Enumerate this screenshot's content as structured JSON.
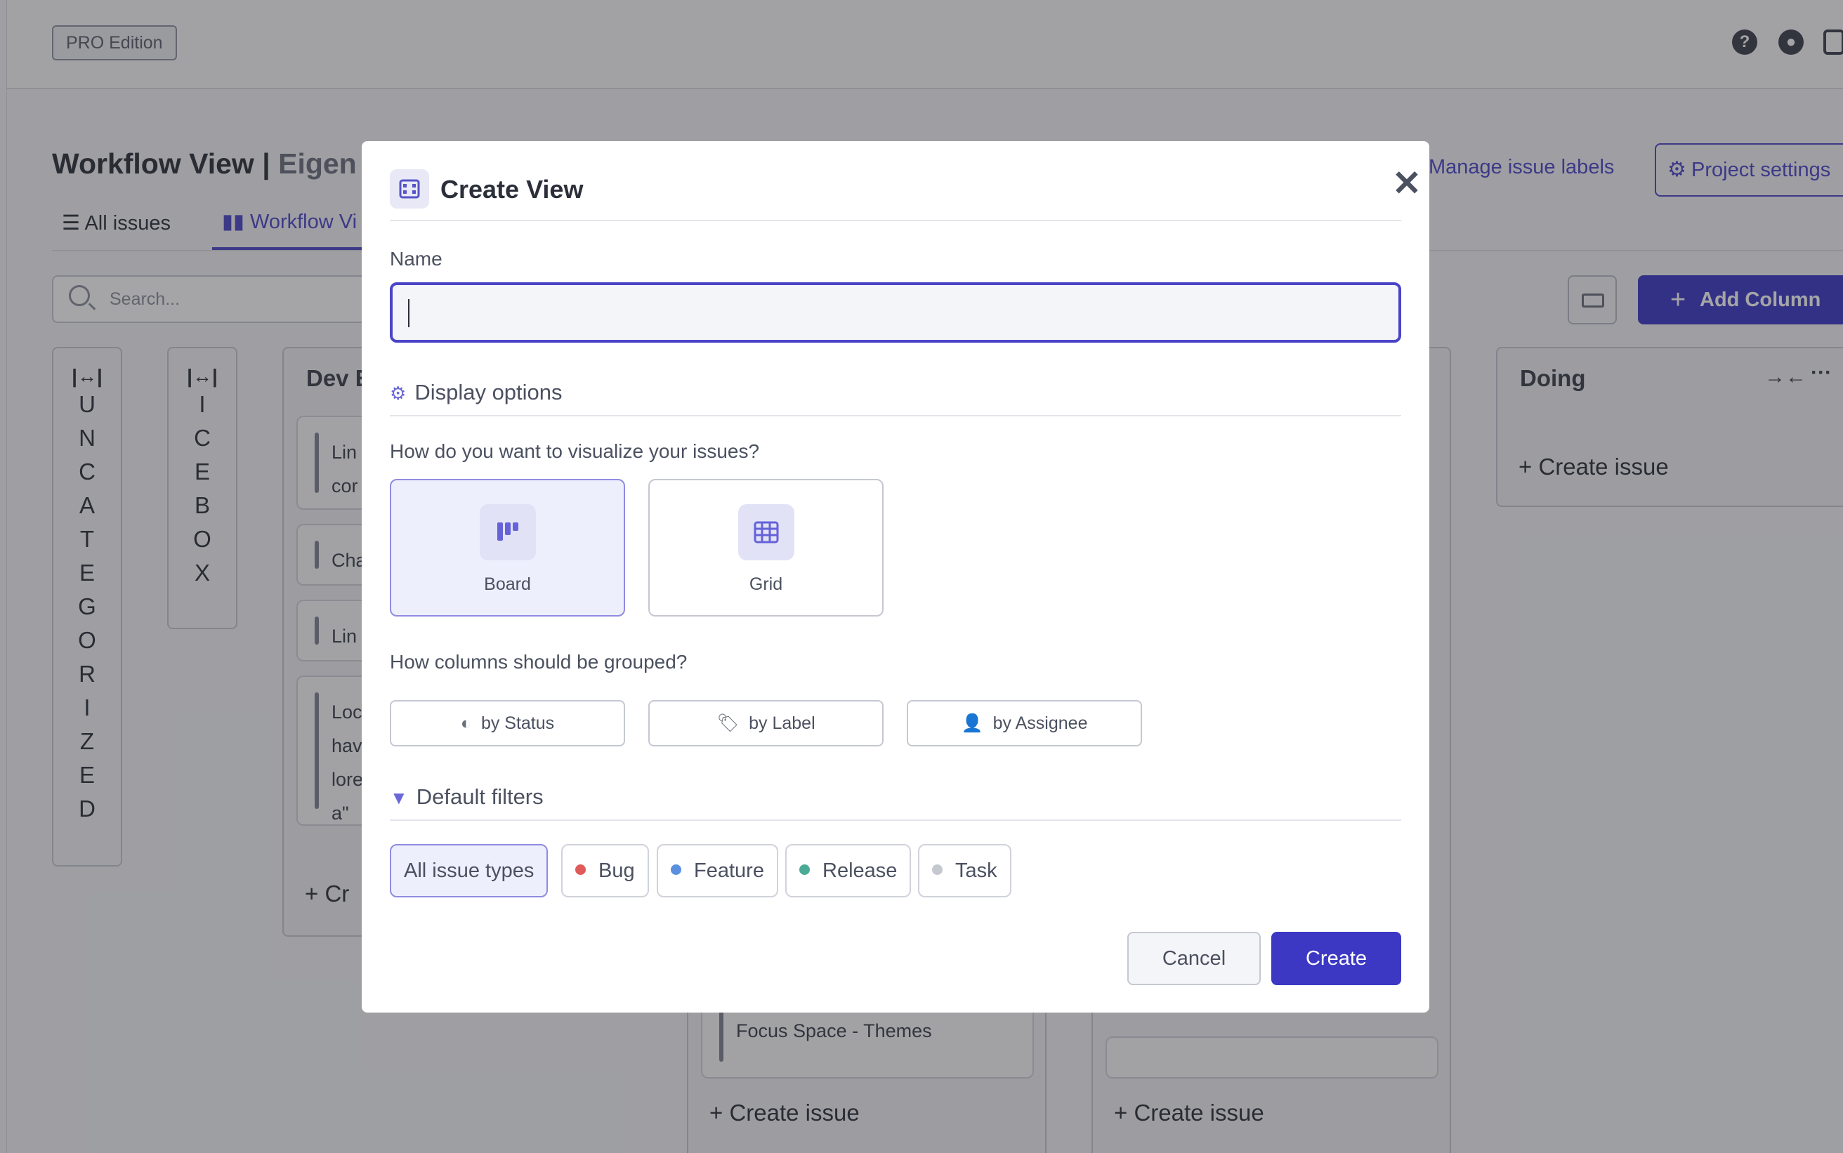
{
  "app": {
    "edition": "PRO Edition",
    "icons": [
      "help-icon",
      "palette-icon",
      "logout-icon"
    ]
  },
  "page": {
    "title": "Workflow View |",
    "subtitle": "Eigen",
    "tabs": [
      {
        "label": "All issues",
        "icon": "list-icon"
      },
      {
        "label": "Workflow Vi",
        "icon": "board-icon",
        "active": true
      }
    ],
    "manage_labels": "Manage issue labels",
    "project_settings": "Project settings",
    "search_placeholder": "Search...",
    "add_column": "Add Column"
  },
  "board": {
    "collapsed_columns": [
      {
        "letters": [
          "U",
          "N",
          "C",
          "A",
          "T",
          "E",
          "G",
          "O",
          "R",
          "I",
          "Z",
          "E",
          "D"
        ]
      },
      {
        "letters": [
          "I",
          "C",
          "E",
          "B",
          "O",
          "X"
        ]
      }
    ],
    "dev_column": {
      "title": "Dev E",
      "cards": [
        "Lin\ncor",
        "Cha",
        "Lin",
        "Loc\nhav\nlore\na\""
      ],
      "create_label": "Cr"
    },
    "middle_card": "Focus Space - Themes",
    "create_issue": "Create issue",
    "doing_column": {
      "title": "Doing",
      "create_label": "Create issue"
    }
  },
  "modal": {
    "title": "Create View",
    "name_label": "Name",
    "name_value": "",
    "display_options": "Display options",
    "visualize_question": "How do you want to visualize your issues?",
    "view_types": [
      {
        "label": "Board",
        "icon": "board-icon",
        "selected": true
      },
      {
        "label": "Grid",
        "icon": "grid-icon",
        "selected": false
      }
    ],
    "group_question": "How columns should be grouped?",
    "group_options": [
      {
        "label": "by Status",
        "icon": "half-circle-icon"
      },
      {
        "label": "by Label",
        "icon": "tags-icon"
      },
      {
        "label": "by Assignee",
        "icon": "user-icon"
      }
    ],
    "default_filters": "Default filters",
    "filters": [
      {
        "label": "All issue types",
        "selected": true
      },
      {
        "label": "Bug",
        "color": "#e05a5a"
      },
      {
        "label": "Feature",
        "color": "#5b8fe0"
      },
      {
        "label": "Release",
        "color": "#4aaa95"
      },
      {
        "label": "Task",
        "color": "#c5c8d0"
      }
    ],
    "cancel": "Cancel",
    "create": "Create"
  },
  "colors": {
    "accent": "#3c38c4",
    "accent_light": "#eeeffd"
  }
}
